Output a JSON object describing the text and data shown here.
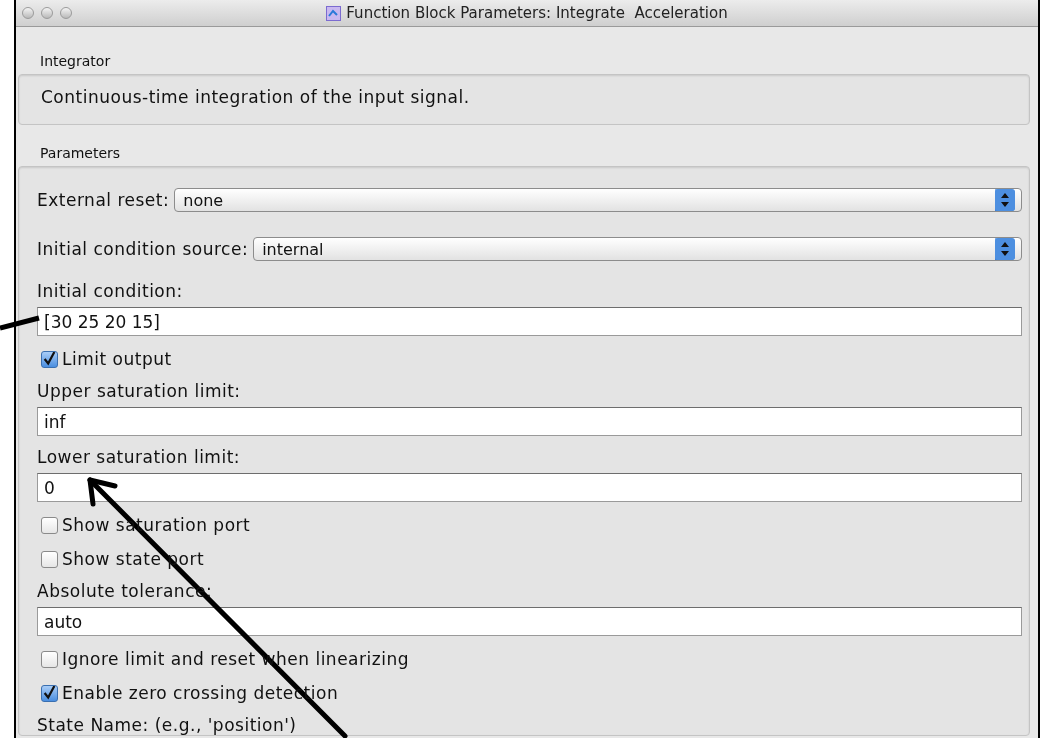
{
  "window": {
    "title": "Function Block Parameters: Integrate  Acceleration"
  },
  "description_group": {
    "title": "Integrator",
    "text": "Continuous-time integration of the input signal."
  },
  "parameters": {
    "title": "Parameters",
    "items": [
      {
        "kind": "select",
        "label": "External reset:",
        "value": "none"
      },
      {
        "kind": "select",
        "label": "Initial condition source:",
        "value": "internal"
      },
      {
        "kind": "field",
        "label": "Initial condition:",
        "value": "[30 25 20 15]"
      },
      {
        "kind": "checkbox",
        "label": "Limit output",
        "checked": true
      },
      {
        "kind": "field",
        "label": "Upper saturation limit:",
        "value": "inf"
      },
      {
        "kind": "field",
        "label": "Lower saturation limit:",
        "value": "0"
      },
      {
        "kind": "checkbox",
        "label": "Show saturation port",
        "checked": false
      },
      {
        "kind": "checkbox",
        "label": "Show state port",
        "checked": false
      },
      {
        "kind": "field",
        "label": "Absolute tolerance:",
        "value": "auto"
      },
      {
        "kind": "checkbox",
        "label": "Ignore limit and reset when linearizing",
        "checked": false
      },
      {
        "kind": "checkbox",
        "label": "Enable zero crossing detection",
        "checked": true
      },
      {
        "kind": "label",
        "label": "State Name: (e.g., 'position')"
      }
    ]
  }
}
